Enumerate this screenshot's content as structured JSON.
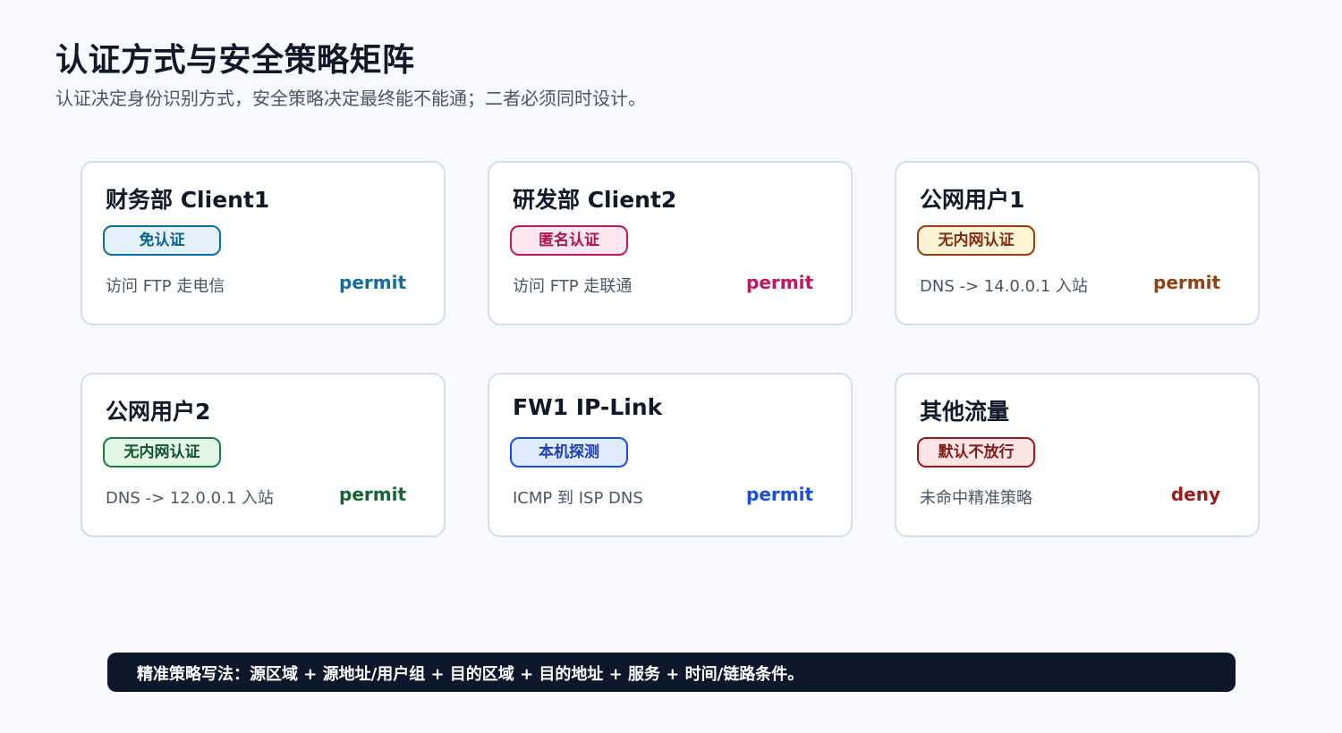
{
  "header": {
    "title": "认证方式与安全策略矩阵",
    "subtitle": "认证决定身份识别方式，安全策略决定最终能不能通；二者必须同时设计。"
  },
  "cards": [
    {
      "title": "财务部 Client1",
      "badge": "免认证",
      "description": "访问 FTP 走电信",
      "action": "permit",
      "colors": {
        "badge_bg": "#e3f2fd",
        "badge_border": "#0f6e9f",
        "badge_text": "#0b5f8a",
        "action": "#0f6e9f"
      }
    },
    {
      "title": "研发部 Client2",
      "badge": "匿名认证",
      "description": "访问 FTP 走联通",
      "action": "permit",
      "colors": {
        "badge_bg": "#fde8f1",
        "badge_border": "#c0185e",
        "badge_text": "#b0124f",
        "action": "#c0185e"
      }
    },
    {
      "title": "公网用户1",
      "badge": "无内网认证",
      "description": "DNS -> 14.0.0.1 入站",
      "action": "permit",
      "colors": {
        "badge_bg": "#fff3d6",
        "badge_border": "#92400e",
        "badge_text": "#7c2d12",
        "action": "#92400e"
      }
    },
    {
      "title": "公网用户2",
      "badge": "无内网认证",
      "description": "DNS -> 12.0.0.1 入站",
      "action": "permit",
      "colors": {
        "badge_bg": "#e2f7e8",
        "badge_border": "#15803d",
        "badge_text": "#14532d",
        "action": "#166534"
      }
    },
    {
      "title": "FW1 IP-Link",
      "badge": "本机探测",
      "description": "ICMP 到 ISP DNS",
      "action": "permit",
      "colors": {
        "badge_bg": "#e0ebff",
        "badge_border": "#1d4ed8",
        "badge_text": "#1e40af",
        "action": "#1d4ed8"
      }
    },
    {
      "title": "其他流量",
      "badge": "默认不放行",
      "description": "未命中精准策略",
      "action": "deny",
      "colors": {
        "badge_bg": "#fde5e5",
        "badge_border": "#991b1b",
        "badge_text": "#7f1d1d",
        "action": "#991b1b"
      }
    }
  ],
  "footer": {
    "text": "精准策略写法：源区域 + 源地址/用户组 + 目的区域 + 目的地址 + 服务 + 时间/链路条件。"
  }
}
